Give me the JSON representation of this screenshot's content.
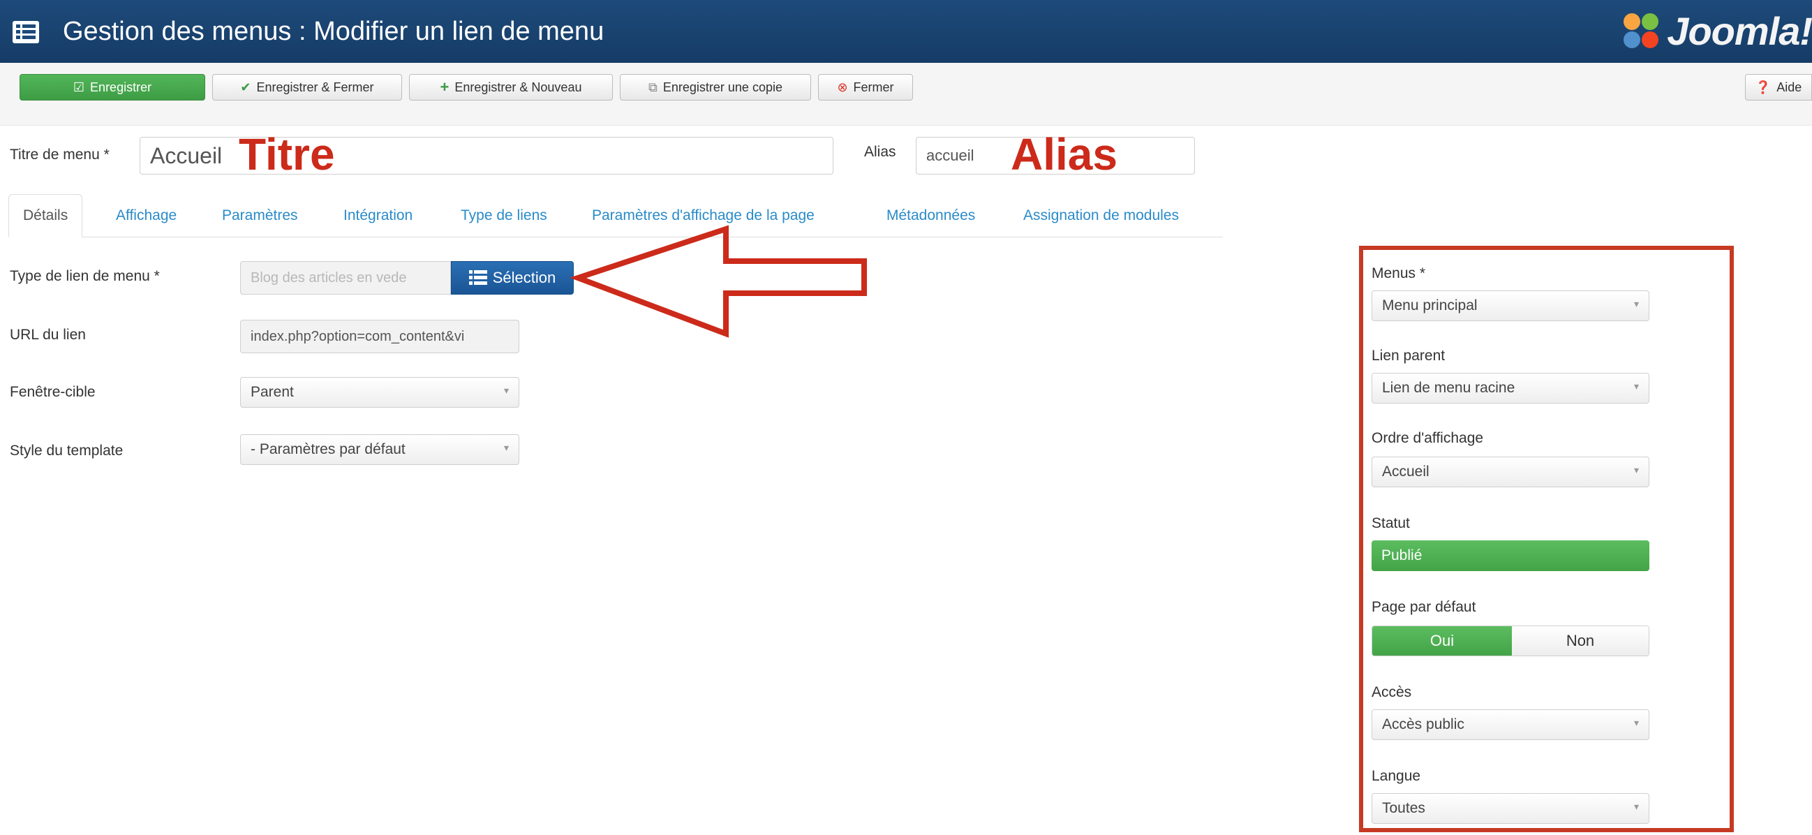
{
  "header": {
    "title": "Gestion des menus : Modifier un lien de menu",
    "brand": "Joomla!",
    "menu_icon": "list-icon",
    "colors": {
      "bar": "#1d4a7a",
      "accent_green": "#43a447",
      "annotation_red": "#cc2a1a"
    }
  },
  "toolbar": {
    "save": "Enregistrer",
    "save_close": "Enregistrer & Fermer",
    "save_new": "Enregistrer & Nouveau",
    "save_copy": "Enregistrer une copie",
    "close": "Fermer",
    "help": "Aide"
  },
  "form": {
    "title_label": "Titre de menu *",
    "title_value": "Accueil",
    "title_annotation": "Titre",
    "alias_label": "Alias",
    "alias_value": "accueil",
    "alias_annotation": "Alias"
  },
  "tabs": [
    {
      "label": "Détails"
    },
    {
      "label": "Affichage"
    },
    {
      "label": "Paramètres"
    },
    {
      "label": "Intégration"
    },
    {
      "label": "Type de liens"
    },
    {
      "label": "Paramètres d'affichage de la page"
    },
    {
      "label": "Métadonnées"
    },
    {
      "label": "Assignation de modules"
    }
  ],
  "details": {
    "type_label": "Type de lien de menu *",
    "type_value": "Blog des articles en vede",
    "select_button": "Sélection",
    "url_label": "URL du lien",
    "url_value": "index.php?option=com_content&vi",
    "target_label": "Fenêtre-cible",
    "target_value": "Parent",
    "style_label": "Style du template",
    "style_value": "- Paramètres par défaut"
  },
  "sidebar": {
    "menus_label": "Menus *",
    "menus_value": "Menu principal",
    "parent_label": "Lien parent",
    "parent_value": "Lien de menu racine",
    "order_label": "Ordre d'affichage",
    "order_value": "Accueil",
    "status_label": "Statut",
    "status_value": "Publié",
    "default_label": "Page par défaut",
    "default_yes": "Oui",
    "default_no": "Non",
    "access_label": "Accès",
    "access_value": "Accès public",
    "language_label": "Langue",
    "language_value": "Toutes"
  }
}
